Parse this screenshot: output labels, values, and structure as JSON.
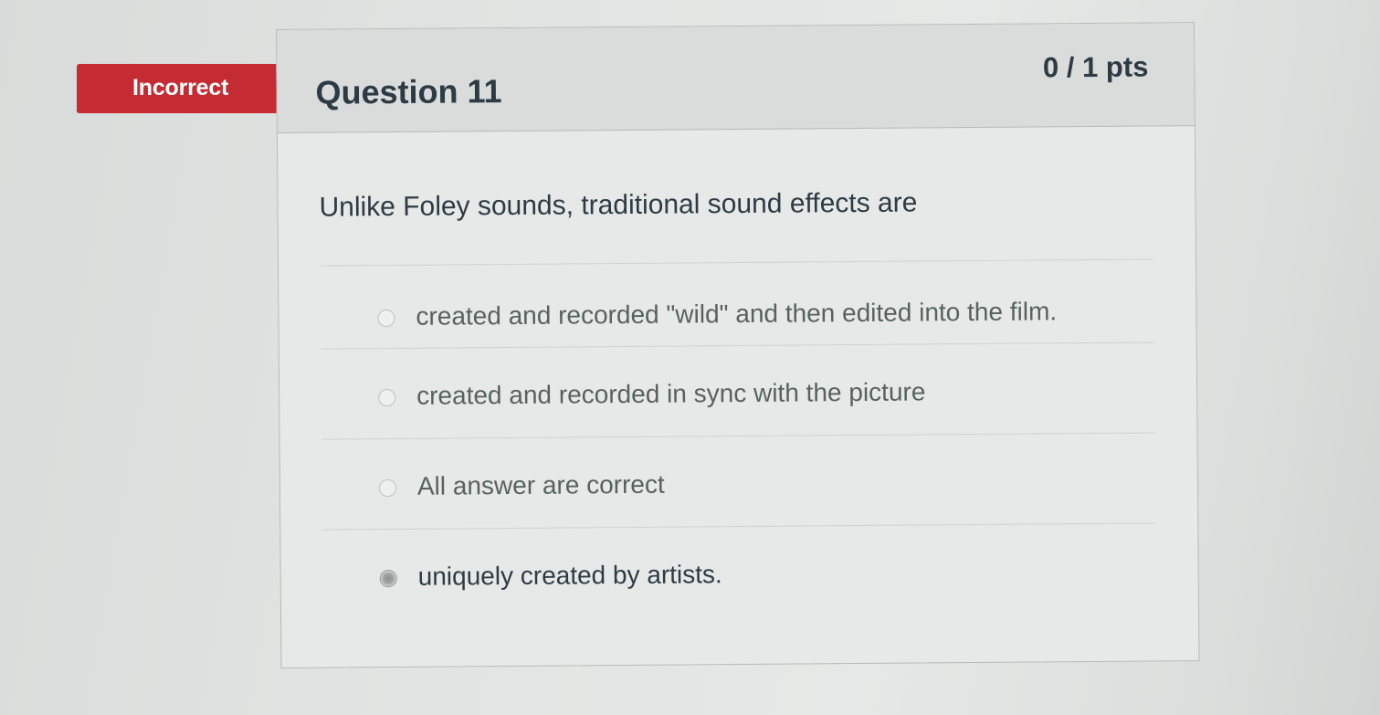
{
  "status": {
    "label": "Incorrect",
    "color": "#c42b32"
  },
  "question": {
    "title": "Question 11",
    "points": "0 / 1 pts",
    "text": "Unlike Foley sounds, traditional sound effects are"
  },
  "answers": [
    {
      "label": "created and recorded \"wild\" and then edited into the film.",
      "selected": false
    },
    {
      "label": "created and recorded in sync with the picture",
      "selected": false
    },
    {
      "label": "All answer are correct",
      "selected": false
    },
    {
      "label": "uniquely created by artists.",
      "selected": true
    }
  ]
}
